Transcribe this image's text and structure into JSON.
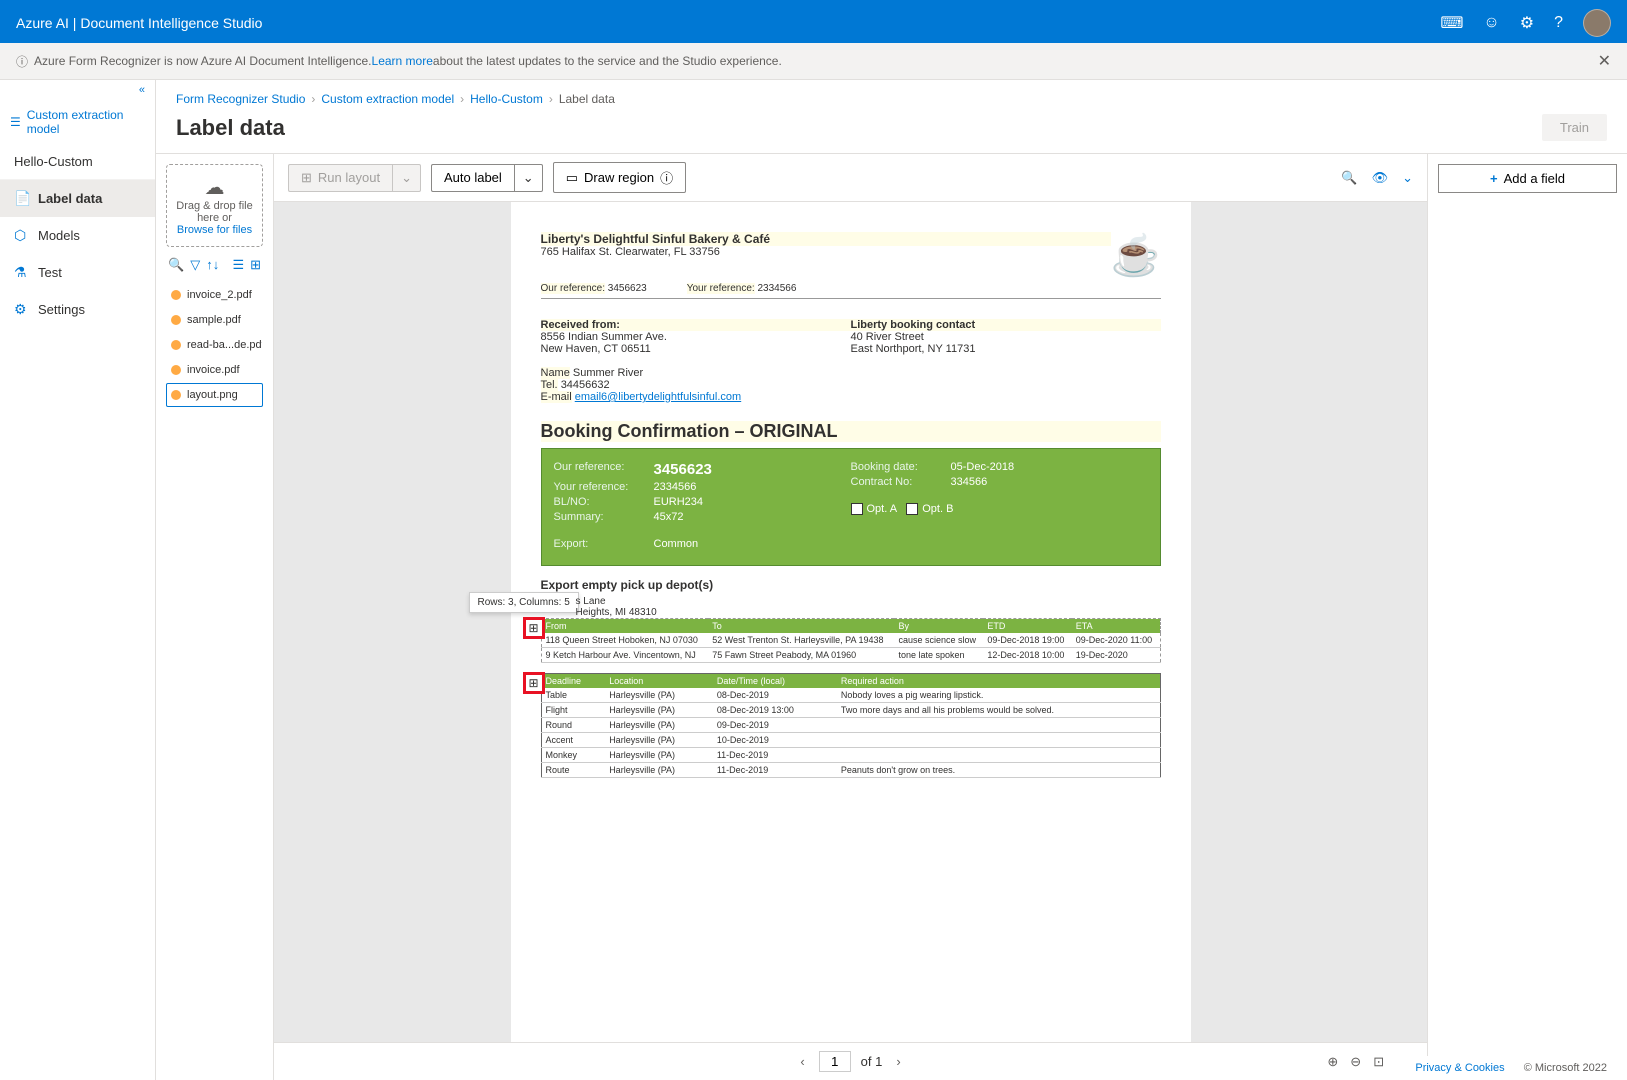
{
  "header": {
    "title": "Azure AI | Document Intelligence Studio",
    "icons": {
      "keyboard": "keyboard-icon",
      "feedback": "feedback-icon",
      "settings": "settings-icon",
      "help": "help-icon"
    }
  },
  "notice": {
    "prefix": "Azure Form Recognizer is now Azure AI Document Intelligence. ",
    "link": "Learn more",
    "suffix": " about the latest updates to the service and the Studio experience."
  },
  "sidebar": {
    "header": "Custom extraction model",
    "project": "Hello-Custom",
    "items": [
      {
        "label": "Label data",
        "icon": "document-icon",
        "active": true
      },
      {
        "label": "Models",
        "icon": "cube-icon",
        "active": false
      },
      {
        "label": "Test",
        "icon": "flask-icon",
        "active": false
      },
      {
        "label": "Settings",
        "icon": "gear-icon",
        "active": false
      }
    ]
  },
  "breadcrumb": {
    "items": [
      "Form Recognizer Studio",
      "Custom extraction model",
      "Hello-Custom",
      "Label data"
    ]
  },
  "page": {
    "title": "Label data",
    "train": "Train"
  },
  "dropzone": {
    "line1": "Drag & drop file here or",
    "link": "Browse for files"
  },
  "files": [
    {
      "name": "invoice_2.pdf",
      "selected": false
    },
    {
      "name": "sample.pdf",
      "selected": false
    },
    {
      "name": "read-ba...de.pdf",
      "selected": false
    },
    {
      "name": "invoice.pdf",
      "selected": false
    },
    {
      "name": "layout.png",
      "selected": true
    }
  ],
  "toolbar": {
    "run_layout": "Run layout",
    "auto_label": "Auto label",
    "draw_region": "Draw region"
  },
  "tooltip": "Rows: 3, Columns: 5",
  "doc": {
    "company": "Liberty's Delightful Sinful Bakery & Café",
    "addr": "765 Halifax St. Clearwater, FL 33756",
    "our_ref_lbl": "Our reference:",
    "our_ref": "3456623",
    "your_ref_lbl": "Your reference:",
    "your_ref": "2334566",
    "received_lbl": "Received from:",
    "received_addr1": "8556 Indian Summer Ave.",
    "received_addr2": "New Haven, CT 06511",
    "contact_lbl": "Liberty booking contact",
    "contact_addr1": "40 River Street",
    "contact_addr2": "East Northport, NY 11731",
    "name_lbl": "Name",
    "name_val": "Summer River",
    "tel_lbl": "Tel.",
    "tel_val": "34456632",
    "email_lbl": "E-mail",
    "email_val": "email6@libertydelightfulsinful.com",
    "heading": "Booking Confirmation – ORIGINAL",
    "box": {
      "our_ref_k": "Our reference:",
      "our_ref_v": "3456623",
      "your_ref_k": "Your reference:",
      "your_ref_v": "2334566",
      "blno_k": "BL/NO:",
      "blno_v": "EURH234",
      "summary_k": "Summary:",
      "summary_v": "45x72",
      "booking_k": "Booking date:",
      "booking_v": "05-Dec-2018",
      "contract_k": "Contract No:",
      "contract_v": "334566",
      "opt_a": "Opt. A",
      "opt_b": "Opt. B",
      "export_k": "Export:",
      "export_v": "Common"
    },
    "section1": "Export empty pick up depot(s)",
    "depot_line1": "s Lane",
    "depot_line2": "Heights, MI 48310",
    "table1": {
      "headers": [
        "From",
        "To",
        "By",
        "ETD",
        "ETA"
      ],
      "rows": [
        [
          "118 Queen Street Hoboken, NJ 07030",
          "52 West Trenton St. Harleysville, PA 19438",
          "cause science slow",
          "09-Dec-2018 19:00",
          "09-Dec-2020 11:00"
        ],
        [
          "9 Ketch Harbour Ave. Vincentown, NJ",
          "75 Fawn Street Peabody, MA 01960",
          "tone late spoken",
          "12-Dec-2018 10:00",
          "19-Dec-2020"
        ]
      ]
    },
    "table2": {
      "headers": [
        "Deadline",
        "Location",
        "Date/Time (local)",
        "Required action"
      ],
      "rows": [
        [
          "Table",
          "Harleysville (PA)",
          "08-Dec-2019",
          "Nobody loves a pig wearing lipstick."
        ],
        [
          "Flight",
          "Harleysville (PA)",
          "08-Dec-2019 13:00",
          "Two more days and all his problems would be solved."
        ],
        [
          "Round",
          "Harleysville (PA)",
          "09-Dec-2019",
          ""
        ],
        [
          "Accent",
          "Harleysville (PA)",
          "10-Dec-2019",
          ""
        ],
        [
          "Monkey",
          "Harleysville (PA)",
          "11-Dec-2019",
          ""
        ],
        [
          "Route",
          "Harleysville (PA)",
          "11-Dec-2019",
          "Peanuts don't grow on trees."
        ]
      ]
    }
  },
  "pager": {
    "page": "1",
    "of": "of 1"
  },
  "fields": {
    "add": "Add a field"
  },
  "footer": {
    "privacy": "Privacy & Cookies",
    "copyright": "© Microsoft 2022"
  }
}
